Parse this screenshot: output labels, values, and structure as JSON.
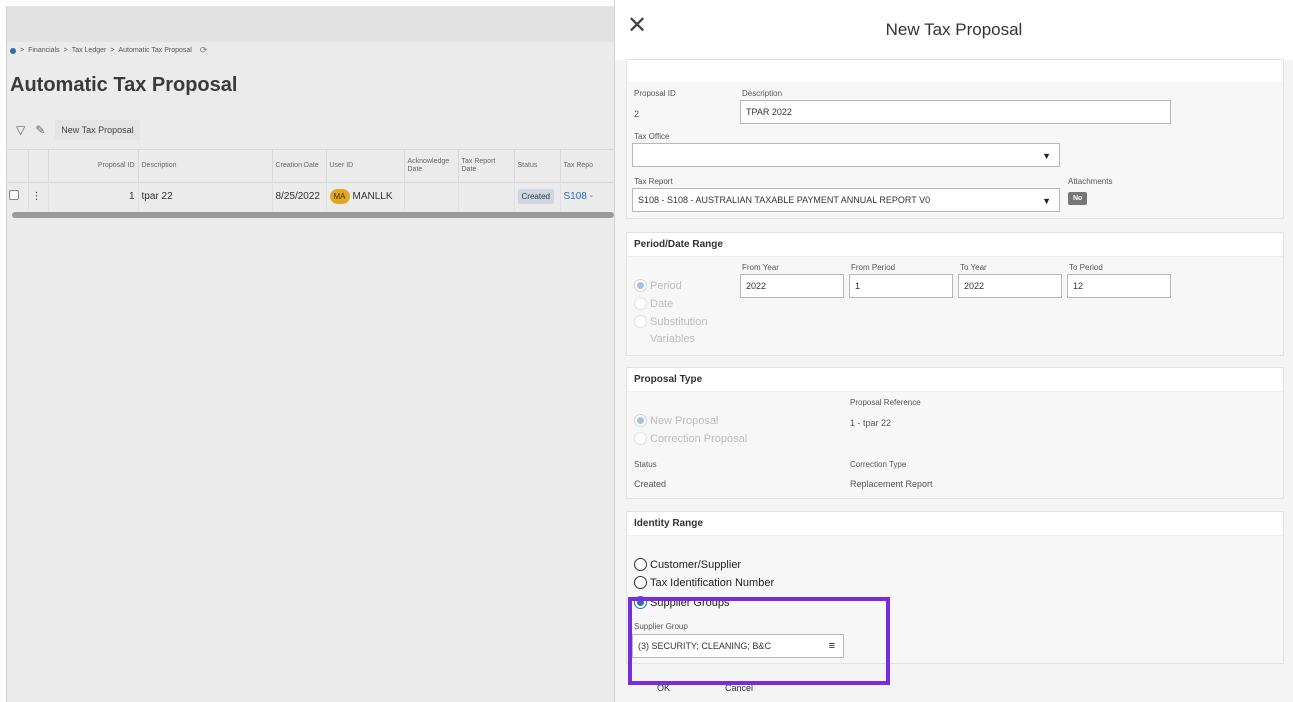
{
  "background": {
    "breadcrumb": [
      "Financials",
      "Tax Ledger",
      "Automatic Tax Proposal"
    ],
    "title": "Automatic Tax Proposal",
    "toolbar": {
      "new_button": "New Tax Proposal"
    },
    "table": {
      "headers": [
        "Proposal ID",
        "Description",
        "Creation Date",
        "User ID",
        "Acknowledge Date",
        "Tax Report Date",
        "Status",
        "Tax Repo"
      ],
      "rows": [
        {
          "proposal_id": "1",
          "description": "tpar 22",
          "creation_date": "8/25/2022",
          "user_initials": "MA",
          "user_id": "MANLLK",
          "status": "Created",
          "tax_report": "S108 -"
        }
      ]
    }
  },
  "panel": {
    "title": "New Tax Proposal",
    "general": {
      "proposal_id_label": "Proposal ID",
      "proposal_id_value": "2",
      "description_label": "Description",
      "description_value": "TPAR 2022",
      "tax_office_label": "Tax Office",
      "tax_office_value": "",
      "tax_report_label": "Tax Report",
      "tax_report_value": "S108 - S108 - AUSTRALIAN TAXABLE PAYMENT ANNUAL REPORT V0",
      "attachments_label": "Attachments",
      "attachments_value": "No"
    },
    "period": {
      "title": "Period/Date Range",
      "options": [
        "Period",
        "Date",
        "Substitution",
        "Variables"
      ],
      "from_year_label": "From Year",
      "from_year": "2022",
      "from_period_label": "From Period",
      "from_period": "1",
      "to_year_label": "To Year",
      "to_year": "2022",
      "to_period_label": "To Period",
      "to_period": "12"
    },
    "proposal_type": {
      "title": "Proposal Type",
      "options": [
        "New Proposal",
        "Correction Proposal"
      ],
      "reference_label": "Proposal Reference",
      "reference_value": "1 - tpar 22",
      "status_label": "Status",
      "status_value": "Created",
      "correction_type_label": "Correction Type",
      "correction_type_value": "Replacement Report"
    },
    "identity": {
      "title": "Identity Range",
      "options": [
        "Customer/Supplier",
        "Tax Identification Number",
        "Supplier Groups"
      ],
      "supplier_group_label": "Supplier Group",
      "supplier_group_value": "(3) SECURITY; CLEANING; B&C"
    },
    "footer": {
      "ok": "OK",
      "cancel": "Cancel"
    }
  },
  "colors": {
    "accent": "#2a6ebb",
    "highlight": "#7a2be0",
    "avatar": "#e0a820"
  }
}
